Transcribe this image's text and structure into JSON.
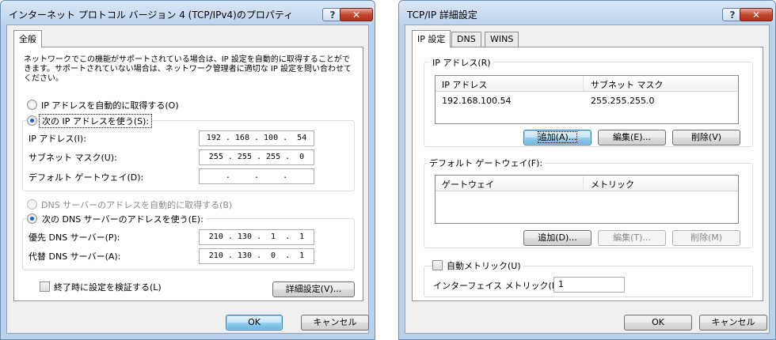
{
  "left_dialog": {
    "title": "インターネット プロトコル バージョン 4 (TCP/IPv4)のプロパティ",
    "help_button": "?",
    "close_button": "✕",
    "tab_general": "全般",
    "description": "ネットワークでこの機能がサポートされている場合は、IP 設定を自動的に取得することができます。サポートされていない場合は、ネットワーク管理者に適切な IP 設定を問い合わせてください。",
    "ip_auto_label": "IP アドレスを自動的に取得する(O)",
    "ip_manual_label": "次の IP アドレスを使う(S):",
    "ip_address_label": "IP アドレス(I):",
    "ip_address_value": "192 . 168 . 100 .  54",
    "subnet_label": "サブネット マスク(U):",
    "subnet_value": "255 . 255 . 255 .  0",
    "gateway_label": "デフォルト ゲートウェイ(D):",
    "gateway_value": "    .     .     .    ",
    "dns_auto_label": "DNS サーバーのアドレスを自動的に取得する(B)",
    "dns_manual_label": "次の DNS サーバーのアドレスを使う(E):",
    "preferred_dns_label": "優先 DNS サーバー(P):",
    "preferred_dns_value": "210 . 130 .  1  .  1",
    "alternate_dns_label": "代替 DNS サーバー(A):",
    "alternate_dns_value": "210 . 130 .  0  .  1",
    "validate_label": "終了時に設定を検証する(L)",
    "advanced_button": "詳細設定(V)...",
    "ok_button": "OK",
    "cancel_button": "キャンセル"
  },
  "right_dialog": {
    "title": "TCP/IP 詳細設定",
    "help_button": "?",
    "close_button": "✕",
    "tabs": [
      "IP 設定",
      "DNS",
      "WINS"
    ],
    "ip_group_label": "IP アドレス(R)",
    "ip_list_headers": [
      "IP アドレス",
      "サブネット マスク"
    ],
    "ip_list_rows": [
      {
        "ip": "192.168.100.54",
        "mask": "255.255.255.0"
      }
    ],
    "ip_add_button": "追加(A)...",
    "ip_edit_button": "編集(E)...",
    "ip_delete_button": "削除(V)",
    "gateway_group_label": "デフォルト ゲートウェイ(F):",
    "gateway_list_headers": [
      "ゲートウェイ",
      "メトリック"
    ],
    "gw_add_button": "追加(D)...",
    "gw_edit_button": "編集(T)...",
    "gw_delete_button": "削除(M)",
    "auto_metric_label": "自動メトリック(U)",
    "interface_metric_label": "インターフェイス メトリック(N):",
    "interface_metric_value": "1",
    "ok_button": "OK",
    "cancel_button": "キャンセル"
  },
  "colors": {
    "frame": "#b9d1ea",
    "close_button": "#c2472f",
    "radio_selected": "#1f5bd6"
  }
}
